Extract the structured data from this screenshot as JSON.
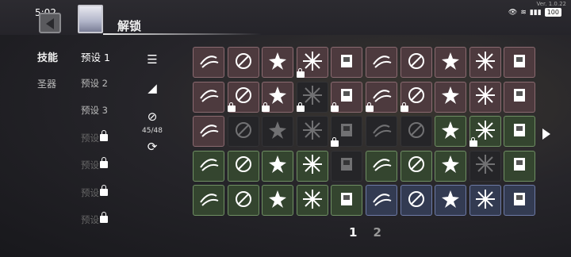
{
  "statusbar": {
    "time": "5:02",
    "battery": "100",
    "version": "Ver. 1.0.22"
  },
  "header": {
    "title": "解锁"
  },
  "tabs": [
    {
      "label": "技能"
    },
    {
      "label": "圣器"
    }
  ],
  "presets": [
    {
      "label": "预设 1",
      "locked": false
    },
    {
      "label": "预设 2",
      "locked": false
    },
    {
      "label": "预设 3",
      "locked": false
    },
    {
      "label": "预设",
      "locked": true
    },
    {
      "label": "预设",
      "locked": true
    },
    {
      "label": "预设",
      "locked": true
    },
    {
      "label": "预设",
      "locked": true
    }
  ],
  "tools": {
    "sort_icon": "sort-icon",
    "edit_icon": "edit-icon",
    "ban_icon": "ban-icon",
    "count": "45/48",
    "reset_icon": "refresh-icon"
  },
  "colors": {
    "red": "#4d3a3e",
    "green": "#34452f",
    "blue": "#333b52",
    "dark": "#252528"
  },
  "skills": [
    {
      "c": "red",
      "l": false,
      "i": "swirl-icon"
    },
    {
      "c": "red",
      "l": false,
      "i": "slash-icon"
    },
    {
      "c": "red",
      "l": false,
      "i": "burst-icon"
    },
    {
      "c": "red",
      "l": false,
      "i": "star-burst-icon"
    },
    {
      "c": "red",
      "l": false,
      "i": "fist-icon"
    },
    {
      "c": "red",
      "l": false,
      "i": "ring-icon"
    },
    {
      "c": "red",
      "l": false,
      "i": "orb-icon"
    },
    {
      "c": "red",
      "l": false,
      "i": "sparkle-ring-icon"
    },
    {
      "c": "red",
      "l": false,
      "i": "arrows-icon"
    },
    {
      "c": "red",
      "l": false,
      "i": "spiral-icon"
    },
    {
      "c": "red",
      "l": false,
      "i": "claw-icon"
    },
    {
      "c": "red",
      "l": false,
      "i": "feathers-icon"
    },
    {
      "c": "red",
      "l": false,
      "i": "leaf-icon"
    },
    {
      "c": "dark",
      "l": true,
      "i": "locked-skill-icon"
    },
    {
      "c": "red",
      "l": false,
      "i": "swords-icon"
    },
    {
      "c": "red",
      "l": false,
      "i": "vortex-icon"
    },
    {
      "c": "red",
      "l": false,
      "i": "target-icon"
    },
    {
      "c": "red",
      "l": false,
      "i": "daggers-icon"
    },
    {
      "c": "red",
      "l": false,
      "i": "fire-icon"
    },
    {
      "c": "red",
      "l": false,
      "i": "scroll-icon"
    },
    {
      "c": "red",
      "l": false,
      "i": "eye-icon"
    },
    {
      "c": "dark",
      "l": true,
      "i": "locked-skill-icon"
    },
    {
      "c": "dark",
      "l": true,
      "i": "locked-skill-icon"
    },
    {
      "c": "dark",
      "l": true,
      "i": "locked-skill-icon"
    },
    {
      "c": "dark",
      "l": true,
      "i": "locked-skill-icon"
    },
    {
      "c": "dark",
      "l": true,
      "i": "locked-skill-icon"
    },
    {
      "c": "dark",
      "l": true,
      "i": "locked-skill-icon"
    },
    {
      "c": "green",
      "l": false,
      "i": "spikes-icon"
    },
    {
      "c": "green",
      "l": false,
      "i": "chain-icon"
    },
    {
      "c": "green",
      "l": false,
      "i": "lightning-icon"
    },
    {
      "c": "green",
      "l": false,
      "i": "sword-icon"
    },
    {
      "c": "green",
      "l": false,
      "i": "shield-icon"
    },
    {
      "c": "green",
      "l": false,
      "i": "skull-icon"
    },
    {
      "c": "green",
      "l": false,
      "i": "biohazard-icon"
    },
    {
      "c": "dark",
      "l": true,
      "i": "locked-skill-icon"
    },
    {
      "c": "green",
      "l": false,
      "i": "potion-icon"
    },
    {
      "c": "green",
      "l": false,
      "i": "boomerang-icon"
    },
    {
      "c": "green",
      "l": false,
      "i": "blades-icon"
    },
    {
      "c": "dark",
      "l": true,
      "i": "locked-skill-icon"
    },
    {
      "c": "green",
      "l": false,
      "i": "web-icon"
    },
    {
      "c": "green",
      "l": false,
      "i": "dust-icon"
    },
    {
      "c": "green",
      "l": false,
      "i": "fang-icon"
    },
    {
      "c": "green",
      "l": false,
      "i": "shuriken-icon"
    },
    {
      "c": "green",
      "l": false,
      "i": "compass-icon"
    },
    {
      "c": "green",
      "l": false,
      "i": "bolt-icon"
    },
    {
      "c": "blue",
      "l": false,
      "i": "robot-icon"
    },
    {
      "c": "blue",
      "l": false,
      "i": "ghost-icon"
    },
    {
      "c": "blue",
      "l": false,
      "i": "hourglass-icon"
    },
    {
      "c": "blue",
      "l": false,
      "i": "runner-icon"
    },
    {
      "c": "blue",
      "l": false,
      "i": "climber-icon"
    }
  ],
  "pagination": {
    "pages": [
      "1",
      "2"
    ],
    "current": 0
  }
}
